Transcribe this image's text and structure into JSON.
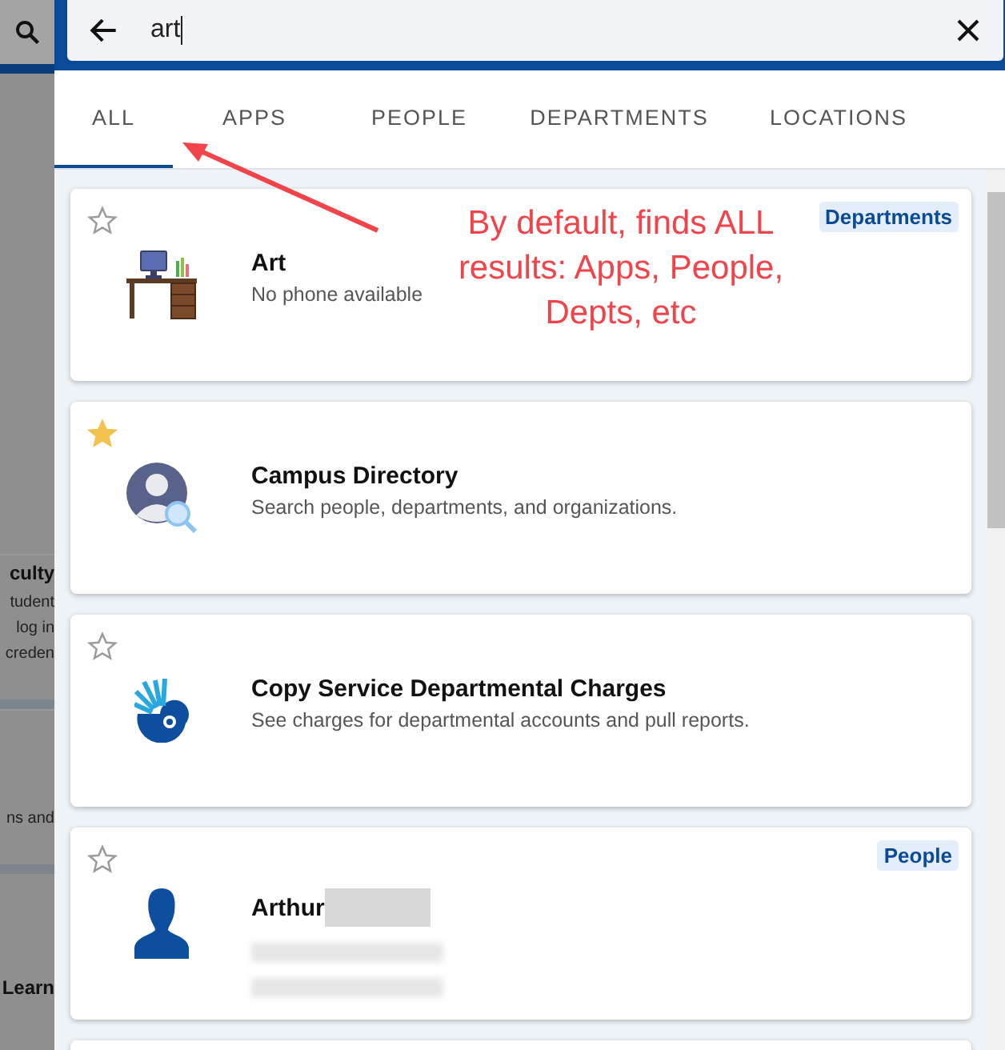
{
  "search": {
    "value": "art"
  },
  "tabs": [
    {
      "label": "ALL",
      "selected": true
    },
    {
      "label": "APPS",
      "selected": false
    },
    {
      "label": "PEOPLE",
      "selected": false
    },
    {
      "label": "DEPARTMENTS",
      "selected": false
    },
    {
      "label": "LOCATIONS",
      "selected": false
    }
  ],
  "results": [
    {
      "kind": "department",
      "title": "Art",
      "lines": [
        "No phone available"
      ],
      "badge": "Departments",
      "starred": false,
      "redacted": false
    },
    {
      "kind": "directory",
      "title": "Campus Directory",
      "lines": [
        "Search people, departments, and organizations."
      ],
      "starred": true,
      "redacted": false
    },
    {
      "kind": "service",
      "title": "Copy Service Departmental Charges",
      "lines": [
        "See charges for departmental accounts and pull reports."
      ],
      "starred": false,
      "redacted": false
    },
    {
      "kind": "person",
      "title": "Arthur",
      "badge": "People",
      "starred": false,
      "redacted": true
    }
  ],
  "annotation": {
    "text": "By default, finds ALL results: Apps, People, Depts, etc"
  },
  "background_fragments": [
    {
      "text": "culty",
      "bold": true
    },
    {
      "text": "tudent",
      "bold": false
    },
    {
      "text": "log in",
      "bold": false
    },
    {
      "text": "creden",
      "bold": false
    },
    {
      "text": "ns and",
      "bold": false
    },
    {
      "text": "Learn",
      "bold": true
    }
  ]
}
